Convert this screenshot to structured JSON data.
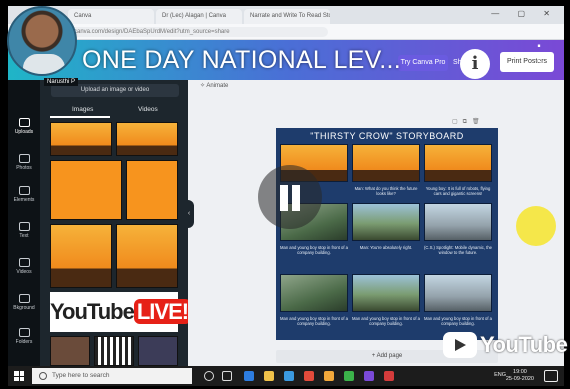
{
  "browser": {
    "tabs": [
      "Canva",
      "Dr (Lec) Alagan | Canva",
      "Narrate and Write To Read Sto...",
      ""
    ],
    "url": "canva.com/design/DAEbaSpUrdM/edit?utm_source=share"
  },
  "canva": {
    "pro_label": "Try Canva Pro",
    "share_label": "Share",
    "print_label": "Print Posters",
    "animate_label": "Animate"
  },
  "video": {
    "title": "ONE DAY NATIONAL LEV...",
    "info_glyph": "i",
    "more_glyph": "⋮",
    "watermark": "YouTube"
  },
  "sidebar": {
    "user_name": "Narusthi P",
    "upload_button": "Upload an image or video",
    "tabs": [
      "Images",
      "Videos"
    ],
    "rail": [
      "Uploads",
      "Photos",
      "Elements",
      "Text",
      "Videos",
      "Bkground",
      "Folders"
    ],
    "ytlive_left": "YouTube",
    "ytlive_right": "LIVE!"
  },
  "storyboard": {
    "title": "\"THIRSTY CROW\" STORYBOARD",
    "captions_row1": [
      "",
      "Man: What do you think the future looks like?",
      "Young boy: It is full of robots, flying cars and gigantic screens!"
    ],
    "captions_row2": [
      "Man and young boy stop in front of a company building.",
      "Man: You're absolutely right.",
      "(C.S.) Spotlight: Mobile dynamic, the window to the future."
    ],
    "captions_row3": [
      "Man and young boy stop in front of a company building.",
      "Man and young boy stop in front of a company building.",
      "Man and young boy stop in front of a company building."
    ],
    "add_page": "+ Add page"
  },
  "taskbar": {
    "search_placeholder": "Type here to search",
    "lang": "ENG",
    "time": "19:00",
    "date": "25-09-2020"
  }
}
